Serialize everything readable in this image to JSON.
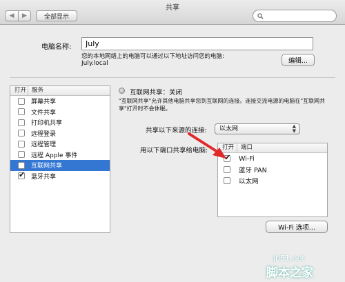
{
  "window": {
    "title": "共享"
  },
  "toolbar": {
    "back": "◀",
    "forward": "▶",
    "show_all": "全部显示",
    "search_placeholder": ""
  },
  "computer": {
    "label": "电脑名称:",
    "name": "July",
    "hint": "您的本地网络上的电脑可以通过以下地址访问您的电脑:",
    "hostname": "July.local",
    "edit_button": "编辑..."
  },
  "services": {
    "header_open": "打开",
    "header_service": "服务",
    "items": [
      {
        "label": "屏幕共享",
        "checked": false
      },
      {
        "label": "文件共享",
        "checked": false
      },
      {
        "label": "打印机共享",
        "checked": false
      },
      {
        "label": "远程登录",
        "checked": false
      },
      {
        "label": "远程管理",
        "checked": false
      },
      {
        "label": "远程 Apple 事件",
        "checked": false
      },
      {
        "label": "互联网共享",
        "checked": false,
        "selected": true
      },
      {
        "label": "蓝牙共享",
        "checked": true
      }
    ]
  },
  "internet_sharing": {
    "status": "互联网共享：关闭",
    "description": "\"互联网共享\"允许其他电脑共享您到互联网的连接。连接交流电源的电脑在\"互联网共享\"打开时不会休眠。",
    "from_label": "共享以下来源的连接:",
    "from_value": "以太网",
    "to_label": "用以下端口共享给电脑:",
    "ports_header_open": "打开",
    "ports_header_port": "端口",
    "ports": [
      {
        "label": "Wi-Fi",
        "checked": true
      },
      {
        "label": "蓝牙 PAN",
        "checked": false
      },
      {
        "label": "以太网",
        "checked": false
      }
    ],
    "wifi_options_button": "Wi-Fi 选项..."
  },
  "watermark": {
    "line1": "jb51.net",
    "line2": "脚本之家"
  },
  "colors": {
    "selection": "#3477d3",
    "arrow": "#e02a2a"
  }
}
